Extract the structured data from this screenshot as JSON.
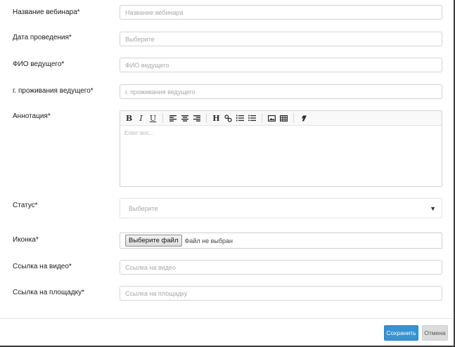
{
  "form": {
    "webinar_name": {
      "label": "Название вебинара*",
      "placeholder": "Название вебинара",
      "value": ""
    },
    "date": {
      "label": "Дата проведения*",
      "placeholder": "Выберите",
      "value": ""
    },
    "host_name": {
      "label": "ФИО ведущего*",
      "placeholder": "ФИО ведущего",
      "value": ""
    },
    "host_city": {
      "label": "г. проживания ведущего*",
      "placeholder": "г. проживания ведущего",
      "value": ""
    },
    "annotation": {
      "label": "Аннотация*",
      "placeholder": "Enter text...",
      "toolbar": {
        "bold": "B",
        "italic": "I",
        "underline": "U",
        "heading": "H",
        "icons": [
          "bold-icon",
          "italic-icon",
          "underline-icon",
          "align-left-icon",
          "align-center-icon",
          "align-right-icon",
          "heading-icon",
          "link-icon",
          "ordered-list-icon",
          "unordered-list-icon",
          "image-icon",
          "table-icon",
          "eraser-icon"
        ]
      }
    },
    "status": {
      "label": "Статус*",
      "selected": "Выберите"
    },
    "icon": {
      "label": "Иконка*",
      "button_label": "Выберите файл",
      "file_status": "Файл не выбран"
    },
    "video_link": {
      "label": "Ссылка на видео*",
      "placeholder": "Ссылка на видео",
      "value": ""
    },
    "venue_link": {
      "label": "Ссылка на площадку*",
      "placeholder": "Ссылка на площадку",
      "value": ""
    }
  },
  "footer": {
    "save_label": "Сохранить",
    "cancel_label": "Отмена"
  },
  "colors": {
    "primary": "#3793d1",
    "cancel": "#dcdcdc",
    "border": "#d4d4d4"
  }
}
